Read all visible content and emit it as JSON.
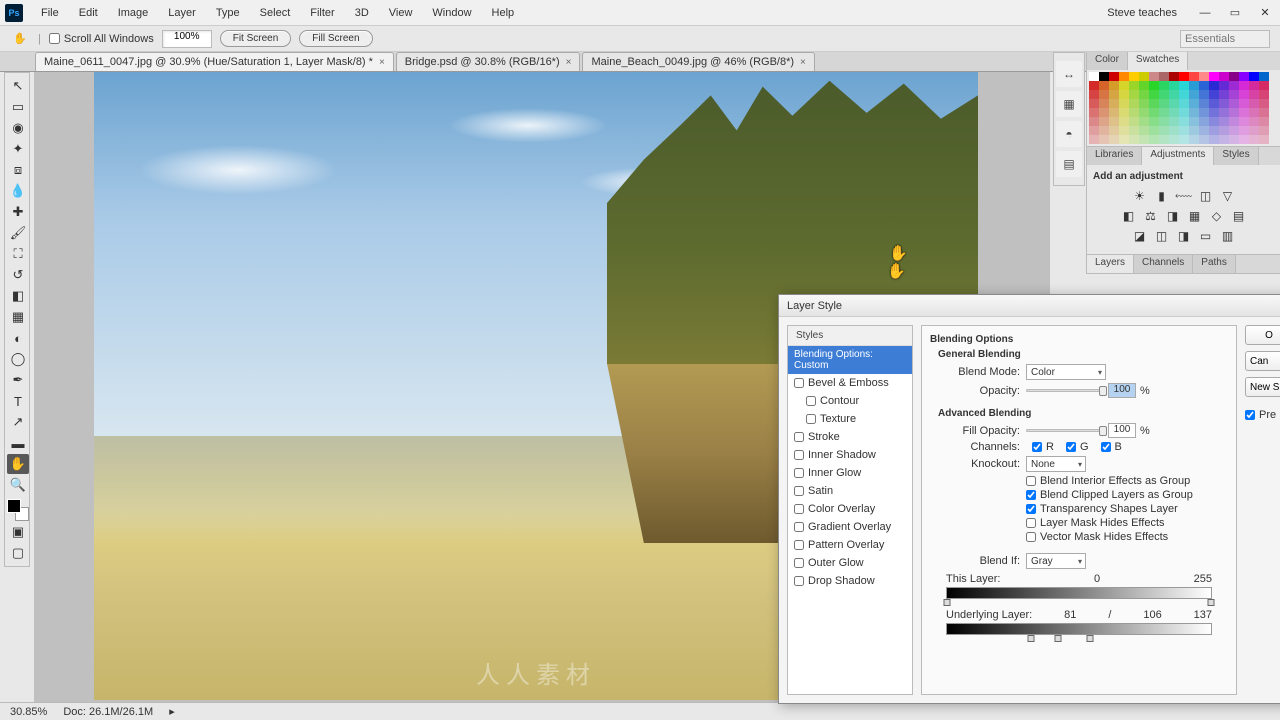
{
  "menubar": {
    "items": [
      "File",
      "Edit",
      "Image",
      "Layer",
      "Type",
      "Select",
      "Filter",
      "3D",
      "View",
      "Window",
      "Help"
    ],
    "user": "Steve teaches"
  },
  "optbar": {
    "scroll_label": "Scroll All Windows",
    "zoom": "100%",
    "fit": "Fit Screen",
    "fill": "Fill Screen",
    "workspace": "Essentials"
  },
  "tabs": [
    {
      "label": "Maine_0611_0047.jpg @ 30.9% (Hue/Saturation 1, Layer Mask/8) *",
      "active": true
    },
    {
      "label": "Bridge.psd @ 30.8% (RGB/16*)",
      "active": false
    },
    {
      "label": "Maine_Beach_0049.jpg @ 46% (RGB/8*)",
      "active": false
    }
  ],
  "status": {
    "zoom": "30.85%",
    "doc": "Doc: 26.1M/26.1M"
  },
  "panels": {
    "color_tabs": [
      "Color",
      "Swatches"
    ],
    "lib_tabs": [
      "Libraries",
      "Adjustments",
      "Styles"
    ],
    "adj_label": "Add an adjustment",
    "layers_tabs": [
      "Layers",
      "Channels",
      "Paths"
    ]
  },
  "dialog": {
    "title": "Layer Style",
    "left": {
      "styles": "Styles",
      "selected": "Blending Options: Custom",
      "items": [
        "Bevel & Emboss",
        "Contour",
        "Texture",
        "Stroke",
        "Inner Shadow",
        "Inner Glow",
        "Satin",
        "Color Overlay",
        "Gradient Overlay",
        "Pattern Overlay",
        "Outer Glow",
        "Drop Shadow"
      ]
    },
    "right_buttons": {
      "ok": "O",
      "cancel": "Can",
      "newstyle": "New S",
      "preview": "Pre"
    },
    "main": {
      "header": "Blending Options",
      "general": "General Blending",
      "blendmode_label": "Blend Mode:",
      "blendmode_val": "Color",
      "opacity_label": "Opacity:",
      "opacity_val": "100",
      "pct": "%",
      "advanced": "Advanced Blending",
      "fill_label": "Fill Opacity:",
      "fill_val": "100",
      "channels_label": "Channels:",
      "ch_r": "R",
      "ch_g": "G",
      "ch_b": "B",
      "knockout_label": "Knockout:",
      "knockout_val": "None",
      "cb1": "Blend Interior Effects as Group",
      "cb2": "Blend Clipped Layers as Group",
      "cb3": "Transparency Shapes Layer",
      "cb4": "Layer Mask Hides Effects",
      "cb5": "Vector Mask Hides Effects",
      "blendif_label": "Blend If:",
      "blendif_val": "Gray",
      "thislayer": "This Layer:",
      "tl_lo": "0",
      "tl_hi": "255",
      "underlying": "Underlying Layer:",
      "ul_lo": "81",
      "ul_mid": "106",
      "ul_hi": "137",
      "ul_slash": "/"
    }
  }
}
